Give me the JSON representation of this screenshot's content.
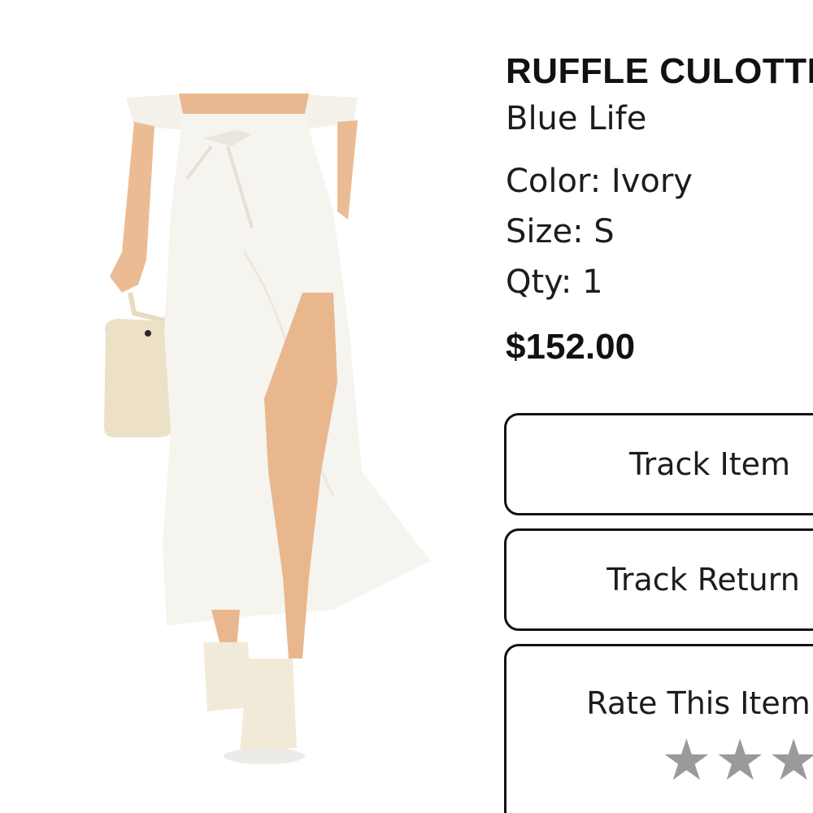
{
  "product": {
    "name": "RUFFLE CULOTTE",
    "brand": "Blue Life",
    "color_label": "Color: Ivory",
    "size_label": "Size: S",
    "qty_label": "Qty: 1",
    "price": "$152.00",
    "image_alt": "ivory wrap ruffle skirt on model"
  },
  "actions": {
    "track_item": "Track Item",
    "track_return": "Track Return",
    "rate": {
      "label": "Rate This Item",
      "star_glyph": "★",
      "star_color": "#9a9a9a",
      "rating": 0,
      "max": 5
    }
  }
}
